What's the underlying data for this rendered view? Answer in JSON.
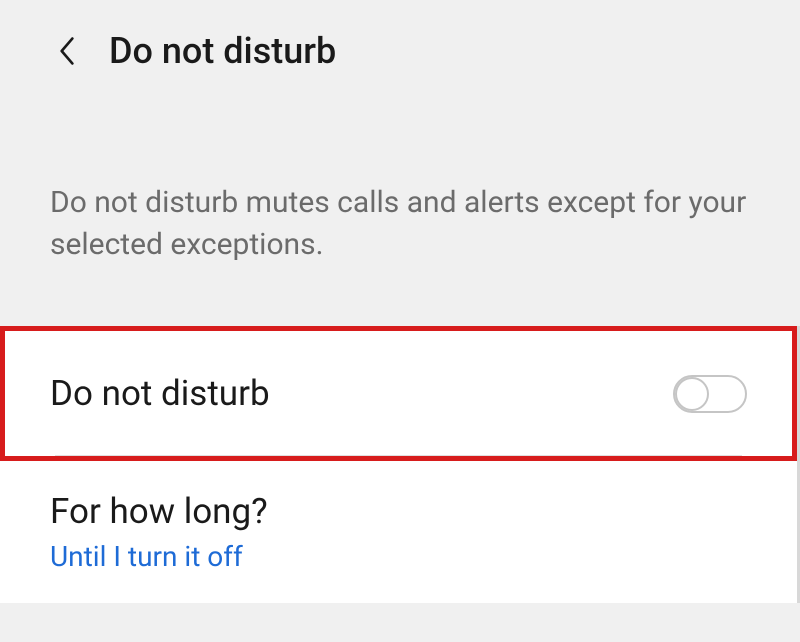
{
  "header": {
    "title": "Do not disturb"
  },
  "description": "Do not disturb mutes calls and alerts except for your selected exceptions.",
  "settings": {
    "dnd": {
      "label": "Do not disturb",
      "enabled": false
    },
    "duration": {
      "label": "For how long?",
      "value": "Until I turn it off"
    }
  }
}
